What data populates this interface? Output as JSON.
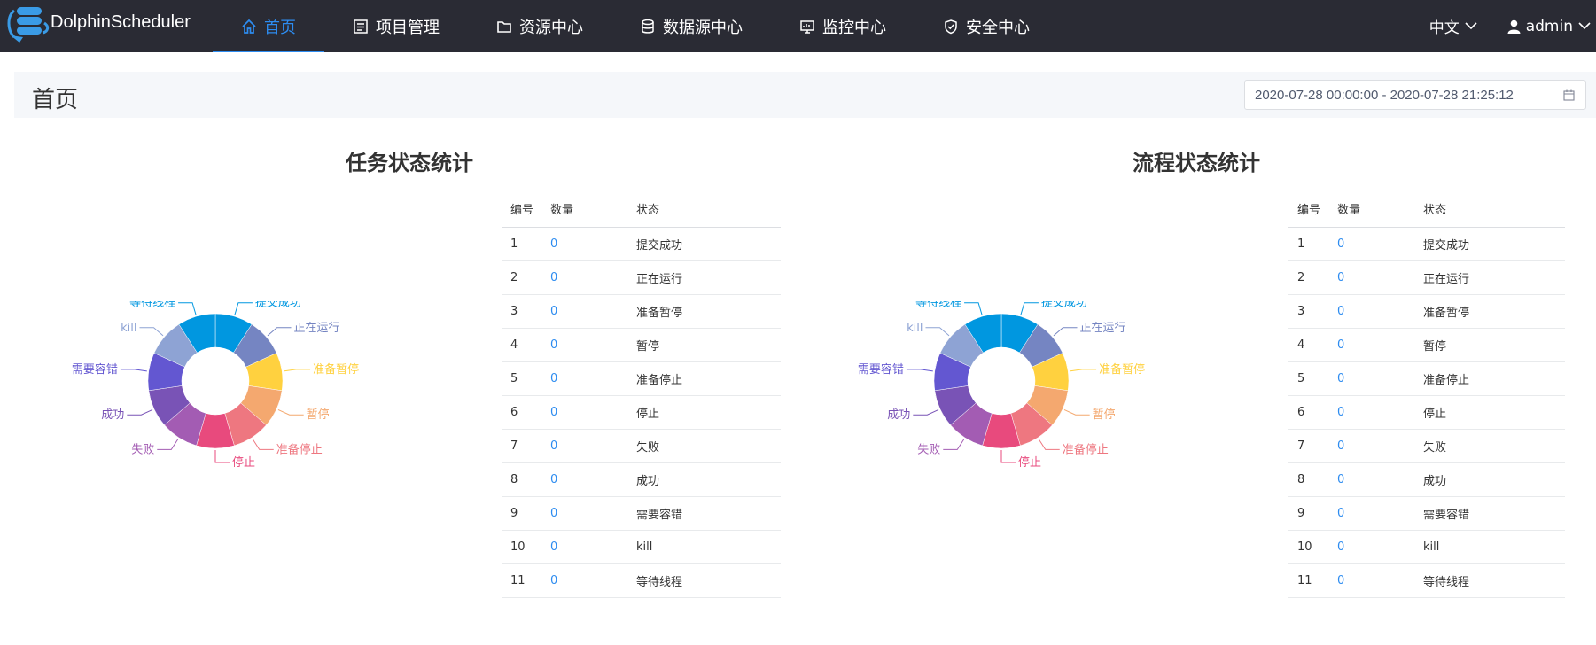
{
  "header": {
    "brand": "DolphinScheduler",
    "nav": [
      {
        "label": "首页",
        "icon": "home-icon",
        "active": true
      },
      {
        "label": "项目管理",
        "icon": "project-icon"
      },
      {
        "label": "资源中心",
        "icon": "folder-icon"
      },
      {
        "label": "数据源中心",
        "icon": "database-icon"
      },
      {
        "label": "监控中心",
        "icon": "monitor-icon"
      },
      {
        "label": "安全中心",
        "icon": "shield-icon"
      }
    ],
    "language": "中文",
    "user": "admin"
  },
  "page": {
    "title": "首页",
    "date_range": "2020-07-28 00:00:00 - 2020-07-28 21:25:12"
  },
  "colors": {
    "topbar": "#2a2b34",
    "accent": "#2d8cf0",
    "slices": [
      "#0097e0",
      "#7585c2",
      "#ffd13f",
      "#f4a86f",
      "#ee7780",
      "#e84a7d",
      "#a35cb3",
      "#7953b6",
      "#6357d1",
      "#8ea3d4",
      "#0097e0"
    ]
  },
  "table_headers": {
    "id": "编号",
    "count": "数量",
    "status": "状态"
  },
  "task_stats": {
    "title": "任务状态统计",
    "rows": [
      {
        "id": "1",
        "count": "0",
        "status": "提交成功"
      },
      {
        "id": "2",
        "count": "0",
        "status": "正在运行"
      },
      {
        "id": "3",
        "count": "0",
        "status": "准备暂停"
      },
      {
        "id": "4",
        "count": "0",
        "status": "暂停"
      },
      {
        "id": "5",
        "count": "0",
        "status": "准备停止"
      },
      {
        "id": "6",
        "count": "0",
        "status": "停止"
      },
      {
        "id": "7",
        "count": "0",
        "status": "失败"
      },
      {
        "id": "8",
        "count": "0",
        "status": "成功"
      },
      {
        "id": "9",
        "count": "0",
        "status": "需要容错"
      },
      {
        "id": "10",
        "count": "0",
        "status": "kill"
      },
      {
        "id": "11",
        "count": "0",
        "status": "等待线程"
      }
    ]
  },
  "process_stats": {
    "title": "流程状态统计",
    "rows": [
      {
        "id": "1",
        "count": "0",
        "status": "提交成功"
      },
      {
        "id": "2",
        "count": "0",
        "status": "正在运行"
      },
      {
        "id": "3",
        "count": "0",
        "status": "准备暂停"
      },
      {
        "id": "4",
        "count": "0",
        "status": "暂停"
      },
      {
        "id": "5",
        "count": "0",
        "status": "准备停止"
      },
      {
        "id": "6",
        "count": "0",
        "status": "停止"
      },
      {
        "id": "7",
        "count": "0",
        "status": "失败"
      },
      {
        "id": "8",
        "count": "0",
        "status": "成功"
      },
      {
        "id": "9",
        "count": "0",
        "status": "需要容错"
      },
      {
        "id": "10",
        "count": "0",
        "status": "kill"
      },
      {
        "id": "11",
        "count": "0",
        "status": "等待线程"
      }
    ]
  },
  "chart_data": [
    {
      "type": "pie",
      "title": "任务状态统计",
      "categories": [
        "提交成功",
        "正在运行",
        "准备暂停",
        "暂停",
        "准备停止",
        "停止",
        "失败",
        "成功",
        "需要容错",
        "kill",
        "等待线程"
      ],
      "values": [
        0,
        0,
        0,
        0,
        0,
        0,
        0,
        0,
        0,
        0,
        0
      ]
    },
    {
      "type": "pie",
      "title": "流程状态统计",
      "categories": [
        "提交成功",
        "正在运行",
        "准备暂停",
        "暂停",
        "准备停止",
        "停止",
        "失败",
        "成功",
        "需要容错",
        "kill",
        "等待线程"
      ],
      "values": [
        0,
        0,
        0,
        0,
        0,
        0,
        0,
        0,
        0,
        0,
        0
      ]
    }
  ]
}
